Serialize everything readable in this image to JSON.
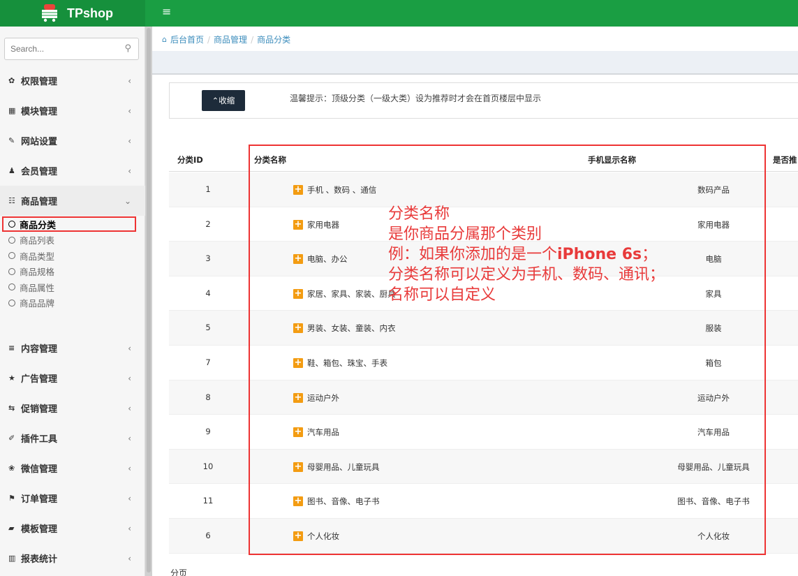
{
  "header": {
    "brand": "TPshop",
    "menu_toggle_icon": "hamburger-icon",
    "color": "#1a9e43"
  },
  "sidebar": {
    "search_placeholder": "Search...",
    "items": [
      {
        "icon": "✿",
        "label": "权限管理",
        "arrow": "‹"
      },
      {
        "icon": "▦",
        "label": "模块管理",
        "arrow": "‹"
      },
      {
        "icon": "✎",
        "label": "网站设置",
        "arrow": "‹"
      },
      {
        "icon": "♟",
        "label": "会员管理",
        "arrow": "‹"
      },
      {
        "icon": "☷",
        "label": "商品管理",
        "arrow": "⌄"
      },
      {
        "icon": "≡",
        "label": "内容管理",
        "arrow": "‹"
      },
      {
        "icon": "★",
        "label": "广告管理",
        "arrow": "‹"
      },
      {
        "icon": "⇆",
        "label": "促销管理",
        "arrow": "‹"
      },
      {
        "icon": "✐",
        "label": "插件工具",
        "arrow": "‹"
      },
      {
        "icon": "❀",
        "label": "微信管理",
        "arrow": "‹"
      },
      {
        "icon": "⚑",
        "label": "订单管理",
        "arrow": "‹"
      },
      {
        "icon": "▰",
        "label": "模板管理",
        "arrow": "‹"
      },
      {
        "icon": "▥",
        "label": "报表统计",
        "arrow": "‹"
      }
    ],
    "sub_items": [
      "商品分类",
      "商品列表",
      "商品类型",
      "商品规格",
      "商品属性",
      "商品品牌"
    ]
  },
  "breadcrumb": {
    "home": "后台首页",
    "section": "商品管理",
    "page": "商品分类",
    "sep": "/"
  },
  "tip": {
    "button": "⌃收缩",
    "text": "温馨提示：顶级分类（一级大类）设为推荐时才会在首页楼层中显示"
  },
  "table": {
    "headers": {
      "id": "分类ID",
      "name": "分类名称",
      "mobile": "手机显示名称",
      "rec": "是否推"
    },
    "rows": [
      {
        "id": "1",
        "name": "手机 、数码 、通信",
        "mobile": "数码产品"
      },
      {
        "id": "2",
        "name": "家用电器",
        "mobile": "家用电器"
      },
      {
        "id": "3",
        "name": "电脑、办公",
        "mobile": "电脑"
      },
      {
        "id": "4",
        "name": "家居、家具、家装、厨具",
        "mobile": "家具"
      },
      {
        "id": "5",
        "name": "男装、女装、童装、内衣",
        "mobile": "服装"
      },
      {
        "id": "7",
        "name": "鞋、箱包、珠宝、手表",
        "mobile": "箱包"
      },
      {
        "id": "8",
        "name": "运动户外",
        "mobile": "运动户外"
      },
      {
        "id": "9",
        "name": "汽车用品",
        "mobile": "汽车用品"
      },
      {
        "id": "10",
        "name": "母婴用品、儿童玩具",
        "mobile": "母婴用品、儿童玩具"
      },
      {
        "id": "11",
        "name": "图书、音像、电子书",
        "mobile": "图书、音像、电子书"
      },
      {
        "id": "6",
        "name": "个人化妆",
        "mobile": "个人化妆"
      }
    ]
  },
  "annotation": {
    "line1": "分类名称",
    "line2": "是你商品分属那个类别",
    "line3_prefix": "例：如果你添加的是一个",
    "line3_bold": "iPhone 6s",
    "line3_suffix": "；",
    "line4": "分类名称可以定义为手机、数码、通讯；",
    "line5": "名称可以自定义",
    "color": "#e83a3a"
  },
  "pager": {
    "label": "分页"
  }
}
